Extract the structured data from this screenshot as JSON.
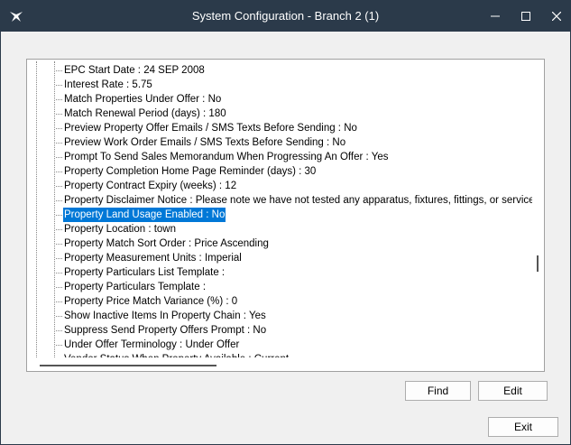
{
  "window": {
    "title": "System Configuration - Branch 2 (1)"
  },
  "tree": {
    "items": [
      {
        "label": "EPC Start Date : 24 SEP 2008",
        "selected": false
      },
      {
        "label": "Interest Rate : 5.75",
        "selected": false
      },
      {
        "label": "Match Properties Under Offer : No",
        "selected": false
      },
      {
        "label": "Match Renewal Period (days) : 180",
        "selected": false
      },
      {
        "label": "Preview Property Offer Emails / SMS Texts Before Sending : No",
        "selected": false
      },
      {
        "label": "Preview Work Order Emails / SMS Texts Before Sending : No",
        "selected": false
      },
      {
        "label": "Prompt To Send Sales Memorandum When Progressing An Offer : Yes",
        "selected": false
      },
      {
        "label": "Property Completion Home Page Reminder (days) : 30",
        "selected": false
      },
      {
        "label": "Property Contract Expiry (weeks) : 12",
        "selected": false
      },
      {
        "label": "Property Disclaimer Notice : Please note we have not tested any apparatus, fixtures, fittings, or services. Purch",
        "selected": false
      },
      {
        "label": "Property Land Usage Enabled : No",
        "selected": true
      },
      {
        "label": "Property Location : town",
        "selected": false
      },
      {
        "label": "Property Match Sort Order : Price Ascending",
        "selected": false
      },
      {
        "label": "Property Measurement Units : Imperial",
        "selected": false
      },
      {
        "label": "Property Particulars List Template :",
        "selected": false
      },
      {
        "label": "Property Particulars Template :",
        "selected": false
      },
      {
        "label": "Property Price Match Variance (%) : 0",
        "selected": false
      },
      {
        "label": "Show Inactive Items In Property Chain : Yes",
        "selected": false
      },
      {
        "label": "Suppress Send Property Offers Prompt : No",
        "selected": false
      },
      {
        "label": "Under Offer Terminology : Under Offer",
        "selected": false
      },
      {
        "label": "Vendor Status When Property Available : Current",
        "selected": false
      }
    ]
  },
  "buttons": {
    "find": "Find",
    "edit": "Edit",
    "exit": "Exit"
  },
  "colors": {
    "titlebar": "#2b3a4a",
    "selection": "#0078d7"
  }
}
